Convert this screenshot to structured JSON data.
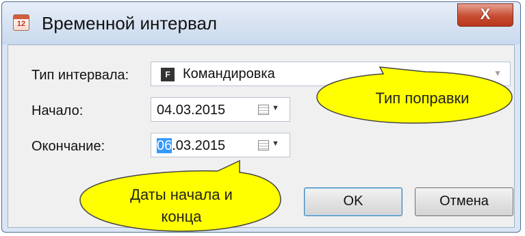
{
  "window": {
    "title": "Временной интервал",
    "icon": "calendar-icon",
    "icon_number": "12"
  },
  "close_label": "X",
  "form": {
    "interval_type": {
      "label": "Тип интервала:",
      "value": "Командировка",
      "icon_letter": "F"
    },
    "start": {
      "label": "Начало:",
      "value": "04.03.2015"
    },
    "end": {
      "label": "Окончание:",
      "value_selected": "06",
      "value_rest": ".03.2015"
    }
  },
  "buttons": {
    "ok": "OK",
    "cancel": "Отмена"
  },
  "callouts": {
    "type_note": "Тип поправки",
    "dates_note_line1": "Даты начала и",
    "dates_note_line2": "конца"
  },
  "colors": {
    "callout_fill": "#ffff00",
    "selection": "#3399ff",
    "close_button": "#c74d32"
  }
}
